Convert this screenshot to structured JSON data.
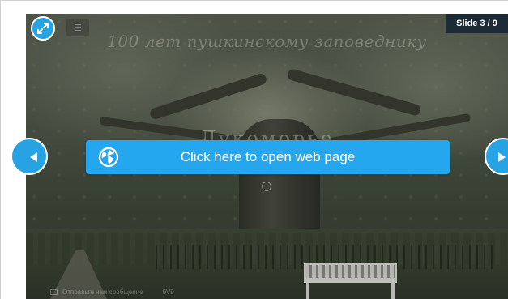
{
  "player": {
    "slide_counter": "Slide 3 / 9",
    "open_web_label": "Click here to open web page"
  },
  "slide": {
    "heading": "100 лет пушкинскому заповеднику",
    "title": "Лукоморье"
  },
  "message_bar": {
    "text": "Отправьте нам сообщение",
    "count": "9V9"
  },
  "colors": {
    "accent": "#27a3e4",
    "button_blue": "#25a7f0",
    "counter_bg": "#1c2b35"
  },
  "icons": {
    "fullscreen": "expand-arrows-icon",
    "menu": "menu-icon",
    "globe": "globe-icon",
    "prev": "chevron-left-icon",
    "next": "chevron-right-icon",
    "message": "envelope-icon"
  }
}
